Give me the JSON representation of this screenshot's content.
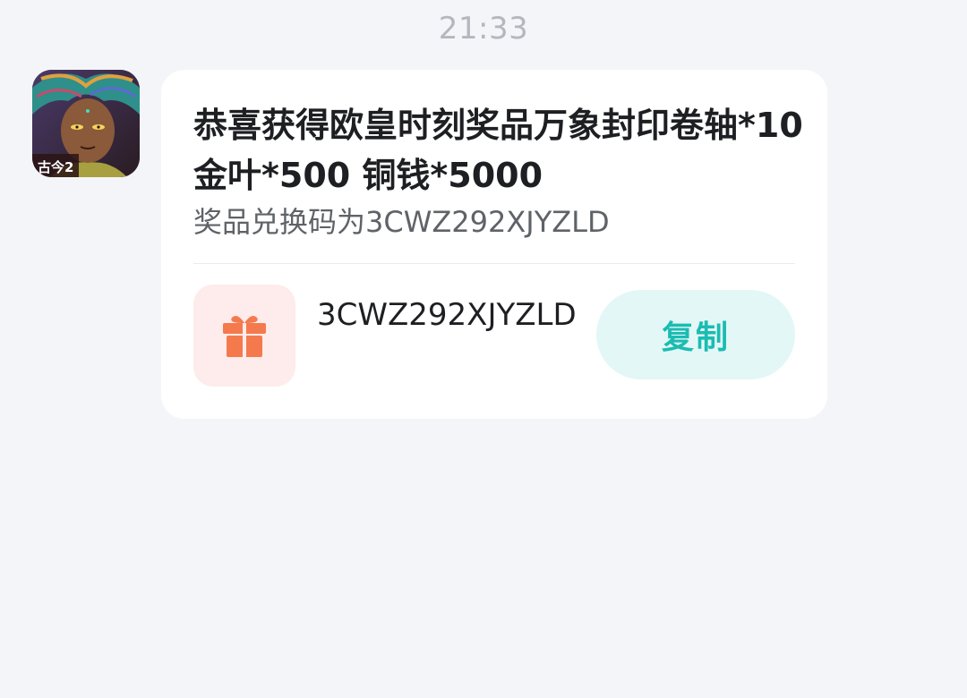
{
  "timestamp": "21:33",
  "sender": {
    "avatar_icon": "game-avatar-icon",
    "avatar_badge_text": "古今2"
  },
  "message": {
    "title": "恭喜获得欧皇时刻奖品万象封印卷轴*10  金叶*500  铜钱*5000",
    "subtitle": "奖品兑换码为3CWZ292XJYZLD",
    "code": "3CWZ292XJYZLD",
    "gift_icon": "gift-icon",
    "copy_label": "复制"
  },
  "colors": {
    "background": "#f4f5f8",
    "card": "#ffffff",
    "accent": "#1bbcb2",
    "copy_button_bg": "#e2f7f6",
    "gift_tile_bg": "#fdeceb",
    "gift_icon": "#f47a4e"
  }
}
